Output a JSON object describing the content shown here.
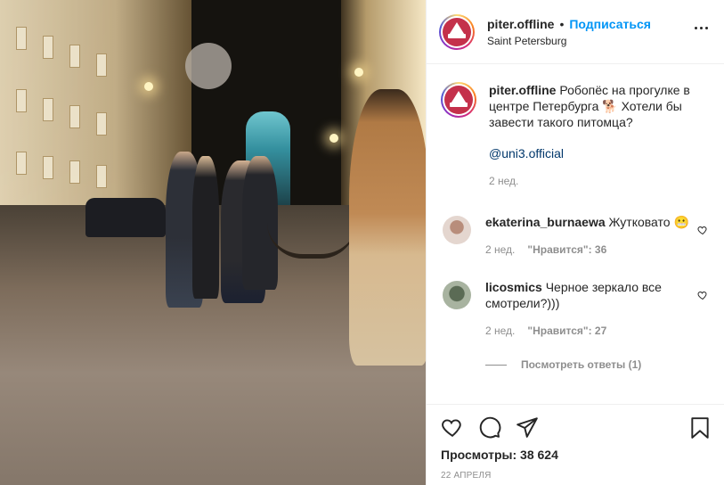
{
  "post": {
    "author": "piter.offline",
    "separator": "•",
    "follow_label": "Подписаться",
    "location": "Saint Petersburg",
    "more_icon": "more-options-icon"
  },
  "caption": {
    "username": "piter.offline",
    "text": "Робопёс на прогулке в центре Петербурга 🐕 Хотели бы завести такого питомца?",
    "mention": "@uni3.official",
    "time": "2 нед."
  },
  "comments": [
    {
      "username": "ekaterina_burnaewa",
      "text": "Жутковато 😬",
      "time": "2 нед.",
      "likes": "\"Нравится\": 36"
    },
    {
      "username": "licosmics",
      "text": "Черное зеркало все смотрели?)))",
      "time": "2 нед.",
      "likes": "\"Нравится\": 27"
    }
  ],
  "replies_label": "Посмотреть ответы (1)",
  "actions": {
    "icons": [
      "heart-icon",
      "comment-icon",
      "share-icon",
      "bookmark-icon"
    ],
    "views": "Просмотры: 38 624",
    "date": "22 апреля"
  },
  "colors": {
    "accent": "#0095f6",
    "text": "#262626",
    "muted": "#8e8e8e",
    "border": "#efefef"
  }
}
